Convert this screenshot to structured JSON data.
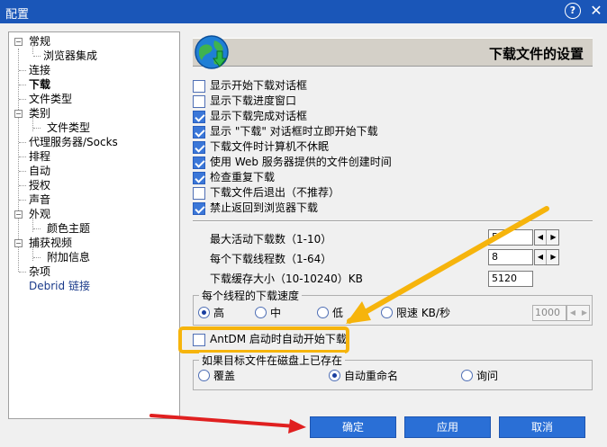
{
  "window": {
    "title": "配置",
    "help_glyph": "?",
    "close_glyph": "✕"
  },
  "tree": {
    "items": [
      {
        "label": "常规",
        "expander": "−"
      },
      {
        "label": "浏览器集成"
      },
      {
        "label": "连接"
      },
      {
        "label": "下载"
      },
      {
        "label": "文件类型"
      },
      {
        "label": "类别",
        "expander": "−"
      },
      {
        "label": "文件类型"
      },
      {
        "label": "代理服务器/Socks"
      },
      {
        "label": "排程"
      },
      {
        "label": "自动"
      },
      {
        "label": "授权"
      },
      {
        "label": "声音"
      },
      {
        "label": "外观",
        "expander": "−"
      },
      {
        "label": "颜色主题"
      },
      {
        "label": "捕获视频",
        "expander": "−"
      },
      {
        "label": "附加信息"
      },
      {
        "label": "杂项"
      },
      {
        "label": "Debrid 链接"
      }
    ]
  },
  "header": {
    "title": "下载文件的设置",
    "icon": "globe-download-icon"
  },
  "options": {
    "items": [
      {
        "label": "显示开始下载对话框",
        "checked": false
      },
      {
        "label": "显示下载进度窗口",
        "checked": false
      },
      {
        "label": "显示下载完成对话框",
        "checked": true
      },
      {
        "label": "显示 \"下载\" 对话框时立即开始下载",
        "checked": true
      },
      {
        "label": "下载文件时计算机不休眠",
        "checked": true
      },
      {
        "label": "使用 Web 服务器提供的文件创建时间",
        "checked": true
      },
      {
        "label": "检查重复下载",
        "checked": true
      },
      {
        "label": "下载文件后退出（不推荐）",
        "checked": false
      },
      {
        "label": "禁止返回到浏览器下载",
        "checked": true
      }
    ]
  },
  "limits": {
    "max_active_label": "最大活动下载数（1-10）",
    "max_active_value": "5",
    "threads_label": "每个下载线程数（1-64）",
    "threads_value": "8",
    "cache_label": "下载缓存大小（10-10240）KB",
    "cache_value": "5120"
  },
  "speed": {
    "group_title": "每个线程的下载速度",
    "options": [
      {
        "label": "高",
        "checked": true
      },
      {
        "label": "中",
        "checked": false
      },
      {
        "label": "低",
        "checked": false
      },
      {
        "label": "限速 KB/秒",
        "checked": false
      }
    ],
    "limit_value": "1000"
  },
  "autostart": {
    "label": "AntDM 启动时自动开始下载",
    "checked": false
  },
  "exists": {
    "group_title": "如果目标文件在磁盘上已存在",
    "options": [
      {
        "label": "覆盖",
        "checked": false
      },
      {
        "label": "自动重命名",
        "checked": true
      },
      {
        "label": "询问",
        "checked": false
      }
    ]
  },
  "buttons": {
    "ok": "确定",
    "apply": "应用",
    "cancel": "取消"
  },
  "annotations": {
    "highlight_color": "#f6b40c",
    "red_arrow_color": "#e02020",
    "orange_arrow_color": "#f6b40c"
  }
}
